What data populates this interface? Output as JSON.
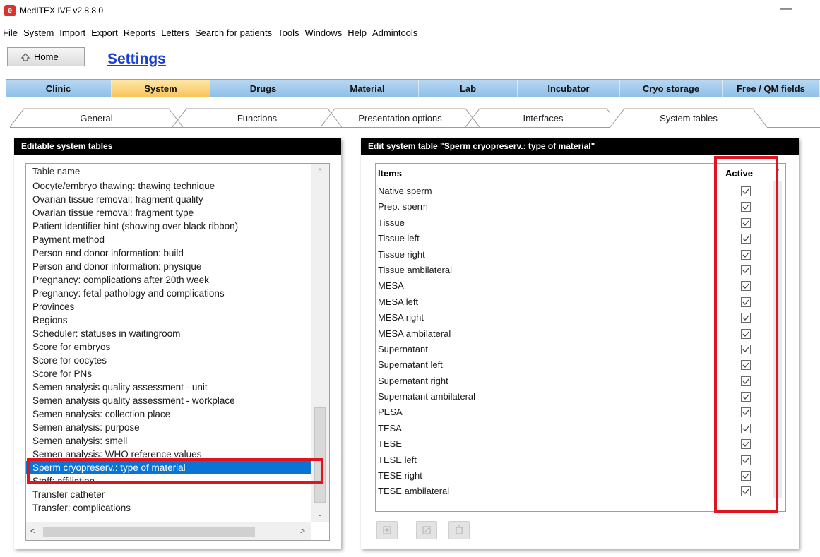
{
  "window": {
    "title": "MedITEX IVF v2.8.8.0",
    "minimize_glyph": "—"
  },
  "menu": [
    "File",
    "System",
    "Import",
    "Export",
    "Reports",
    "Letters",
    "Search for patients",
    "Tools",
    "Windows",
    "Help",
    "Admintools"
  ],
  "toolbar": {
    "home_label": "Home",
    "page_title": "Settings"
  },
  "main_tabs": [
    {
      "label": "Clinic",
      "active": false
    },
    {
      "label": "System",
      "active": true
    },
    {
      "label": "Drugs",
      "active": false
    },
    {
      "label": "Material",
      "active": false
    },
    {
      "label": "Lab",
      "active": false
    },
    {
      "label": "Incubator",
      "active": false
    },
    {
      "label": "Cryo storage",
      "active": false
    },
    {
      "label": "Free / QM fields",
      "active": false
    }
  ],
  "sub_tabs": [
    {
      "label": "General",
      "active": false
    },
    {
      "label": "Functions",
      "active": false
    },
    {
      "label": "Presentation options",
      "active": false
    },
    {
      "label": "Interfaces",
      "active": false
    },
    {
      "label": "System tables",
      "active": true
    }
  ],
  "left_panel": {
    "title": "Editable system tables",
    "column_header": "Table name",
    "items": [
      "Oocyte/embryo thawing: thawing technique",
      "Ovarian tissue removal: fragment quality",
      "Ovarian tissue removal: fragment type",
      "Patient identifier hint (showing over black ribbon)",
      "Payment method",
      "Person and donor information: build",
      "Person and donor information: physique",
      "Pregnancy: complications after 20th week",
      "Pregnancy: fetal pathology and complications",
      "Provinces",
      "Regions",
      "Scheduler: statuses in waitingroom",
      "Score for embryos",
      "Score for oocytes",
      "Score for PNs",
      "Semen analysis quality assessment - unit",
      "Semen analysis quality assessment - workplace",
      "Semen analysis: collection place",
      "Semen analysis: purpose",
      "Semen analysis: smell",
      "Semen analysis: WHO reference values",
      "Sperm cryopreserv.: type of material",
      "Staff: affiliation",
      "Transfer catheter",
      "Transfer: complications"
    ],
    "selected_index": 21
  },
  "right_panel": {
    "title": "Edit system table \"Sperm cryopreserv.: type of material\"",
    "col_items": "Items",
    "col_active": "Active",
    "rows": [
      {
        "item": "Native sperm",
        "active": true
      },
      {
        "item": "Prep. sperm",
        "active": true
      },
      {
        "item": "Tissue",
        "active": true
      },
      {
        "item": "Tissue left",
        "active": true
      },
      {
        "item": "Tissue right",
        "active": true
      },
      {
        "item": "Tissue ambilateral",
        "active": true
      },
      {
        "item": "MESA",
        "active": true
      },
      {
        "item": "MESA left",
        "active": true
      },
      {
        "item": "MESA right",
        "active": true
      },
      {
        "item": "MESA ambilateral",
        "active": true
      },
      {
        "item": "Supernatant",
        "active": true
      },
      {
        "item": "Supernatant left",
        "active": true
      },
      {
        "item": "Supernatant right",
        "active": true
      },
      {
        "item": "Supernatant ambilateral",
        "active": true
      },
      {
        "item": "PESA",
        "active": true
      },
      {
        "item": "TESA",
        "active": true
      },
      {
        "item": "TESE",
        "active": true
      },
      {
        "item": "TESE left",
        "active": true
      },
      {
        "item": "TESE right",
        "active": true
      },
      {
        "item": "TESE ambilateral",
        "active": true
      }
    ],
    "action_buttons": [
      "add-row-icon",
      "edit-row-icon",
      "delete-row-icon"
    ]
  },
  "colors": {
    "accent_blue": "#0a74d6",
    "title_blue": "#1a3fd6",
    "highlight_red": "#e0141e",
    "active_tab": "#f8c55a",
    "tab_blue": "#8fc0e8"
  }
}
